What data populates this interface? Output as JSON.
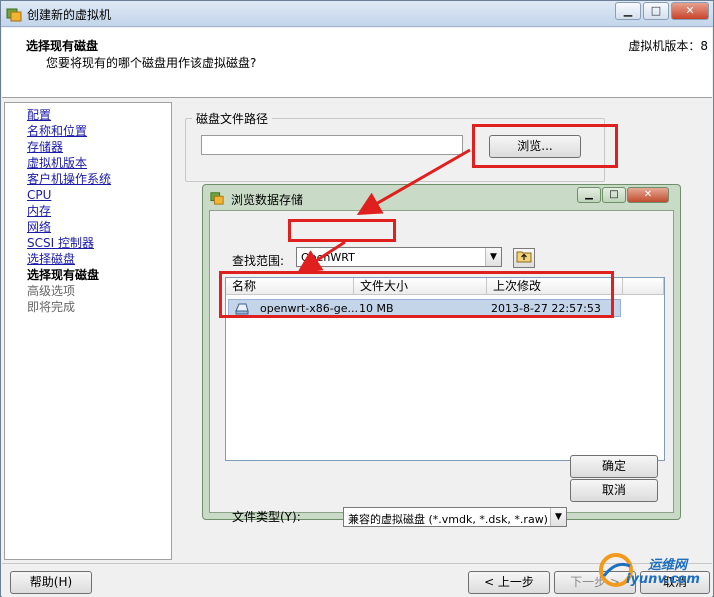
{
  "window": {
    "title": "创建新的虚拟机",
    "controls": {
      "minimize": "▁",
      "maximize": "□",
      "close": "✕"
    }
  },
  "header": {
    "title": "选择现有磁盘",
    "subtitle": "您要将现有的哪个磁盘用作该虚拟磁盘?",
    "version": "虚拟机版本：8"
  },
  "sidebar": {
    "items": [
      {
        "label": "配置",
        "state": "link"
      },
      {
        "label": "名称和位置",
        "state": "link"
      },
      {
        "label": "存储器",
        "state": "link"
      },
      {
        "label": "虚拟机版本",
        "state": "link"
      },
      {
        "label": "客户机操作系统",
        "state": "link"
      },
      {
        "label": "CPU",
        "state": "link"
      },
      {
        "label": "内存",
        "state": "link"
      },
      {
        "label": "网络",
        "state": "link"
      },
      {
        "label": "SCSI 控制器",
        "state": "link"
      },
      {
        "label": "选择磁盘",
        "state": "link"
      },
      {
        "label": "选择现有磁盘",
        "state": "current"
      },
      {
        "label": "高级选项",
        "state": "pending"
      },
      {
        "label": "即将完成",
        "state": "pending"
      }
    ]
  },
  "disk_path": {
    "legend": "磁盘文件路径",
    "value": "",
    "browse_label": "浏览..."
  },
  "dialog": {
    "title": "浏览数据存储",
    "lookin_label": "查找范围:",
    "lookin_value": "OpenWRT",
    "columns": [
      "名称",
      "文件大小",
      "上次修改"
    ],
    "files": [
      {
        "name": "openwrt-x86-ge...",
        "size": "10 MB",
        "modified": "2013-8-27 22:57:53"
      }
    ],
    "filetype_label": "文件类型(Y):",
    "filetype_value": "兼容的虚拟磁盘 (*.vmdk, *.dsk, *.raw)",
    "ok_label": "确定",
    "cancel_label": "取消"
  },
  "footer": {
    "help_label": "帮助(H)",
    "back_label": "< 上一步",
    "next_label": "下一步 >",
    "cancel_label": "取消"
  },
  "watermark": {
    "line1": "运维网",
    "line2": "iyunv.com"
  },
  "colors": {
    "annotation_red": "#e01f1f",
    "link_blue": "#1a1aa8",
    "selection": "#c4d5ea"
  }
}
